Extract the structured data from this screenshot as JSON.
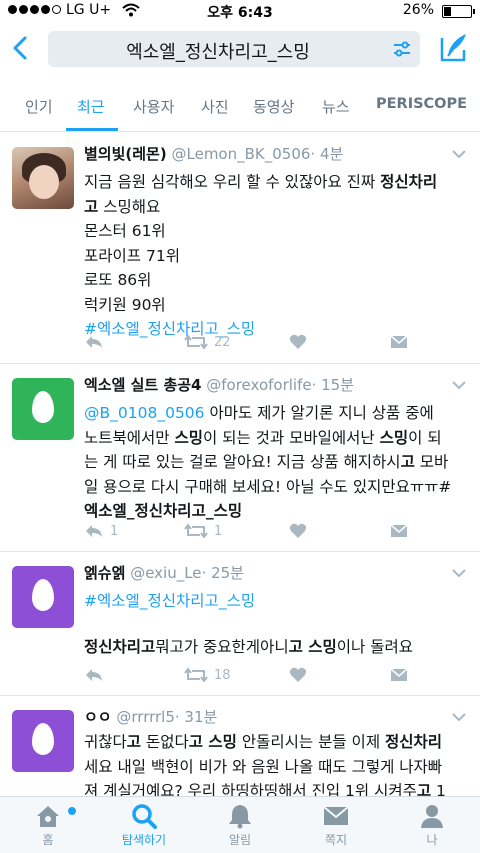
{
  "status_bar": {
    "carrier": "LG U+",
    "time": "오후 6:43",
    "battery": "26%",
    "battery_level": 0.26
  },
  "search": {
    "query": "엑소엘_정신차리고_스밍"
  },
  "tabs": [
    {
      "label": "인기",
      "active": false
    },
    {
      "label": "최근",
      "active": true
    },
    {
      "label": "사용자",
      "active": false
    },
    {
      "label": "사진",
      "active": false
    },
    {
      "label": "동영상",
      "active": false
    },
    {
      "label": "뉴스",
      "active": false
    },
    {
      "label": "PERISCOPE",
      "active": false
    }
  ],
  "tweets": [
    {
      "name": "별의빛(레몬)",
      "handle": "@Lemon_BK_0506",
      "time": "· 4분",
      "lines": {
        "l1a": "지금 음원 심각해오 우리 할 수 있잖아요 진짜 ",
        "l1b": "정신차리",
        "l2a": "고",
        "l2b": " 스밍해요",
        "l3": "몬스터 61위",
        "l4": "포라이프 71위",
        "l5": "로또 86위",
        "l6": "럭키원 90위",
        "l7": "#엑소엘_정신차리고_스밍"
      },
      "retweets": "22",
      "replies": "",
      "likes": ""
    },
    {
      "name": "엑소엘 실트 총공4",
      "handle": "@forexoforlife",
      "time": "· 15분",
      "lines": {
        "l1a": "@B_0108_0506",
        "l1b": " 아마도 제가 알기론 지니 상품 중에",
        "l2a": "노트북에서만 ",
        "l2b": "스밍",
        "l2c": "이 되는 것과 모바일에서난 ",
        "l2d": "스밍",
        "l2e": "이 되",
        "l3a": "는 게 따로 있는 걸로 알아요! 지금 상품 해지하시",
        "l3b": "고",
        "l3c": " 모바",
        "l4": "일 용으로 다시 구매해 보세요! 아닐 수도 있지만요ㅠㅠ#",
        "l5": "엑소엘_정신차리고_스밍"
      },
      "replies": "1",
      "retweets": "1",
      "likes": ""
    },
    {
      "name": "엙슈엙",
      "handle": "@exiu_Le",
      "time": "· 25분",
      "lines": {
        "l1": "#엑소엘_정신차리고_스밍",
        "l2a": "정신차리고",
        "l2b": "뭐고가 중요한게아니",
        "l2c": "고 스밍",
        "l2d": "이나 돌려요"
      },
      "retweets": "18",
      "replies": "",
      "likes": ""
    },
    {
      "name": "ㅇㅇ",
      "handle": "@rrrrrl5",
      "time": "· 31분",
      "lines": {
        "l1a": "귀찮다",
        "l1b": "고",
        "l1c": " 돈없다",
        "l1d": "고 스밍",
        "l1e": " 안돌리시는 분들 이제 ",
        "l1f": "정신차리",
        "l2": "세요 내일 백현이 비가 와 음원 나올 때도 그렇게 나자빠",
        "l3a": "져 계실거예요? 우리 하띵하띵해서 진입 1위 시켜주",
        "l3b": "고",
        "l3c": " 1"
      }
    }
  ],
  "tabbar": [
    {
      "label": "홈",
      "icon": "home-icon",
      "active": false,
      "dot": true
    },
    {
      "label": "탐색하기",
      "icon": "search-icon",
      "active": true
    },
    {
      "label": "알림",
      "icon": "bell-icon",
      "active": false
    },
    {
      "label": "쪽지",
      "icon": "envelope-icon",
      "active": false
    },
    {
      "label": "나",
      "icon": "person-icon",
      "active": false
    }
  ],
  "colors": {
    "accent": "#1da1f2",
    "muted": "#8899a6",
    "green_egg": "#2fb45a",
    "purple_egg": "#8c4fd6"
  }
}
